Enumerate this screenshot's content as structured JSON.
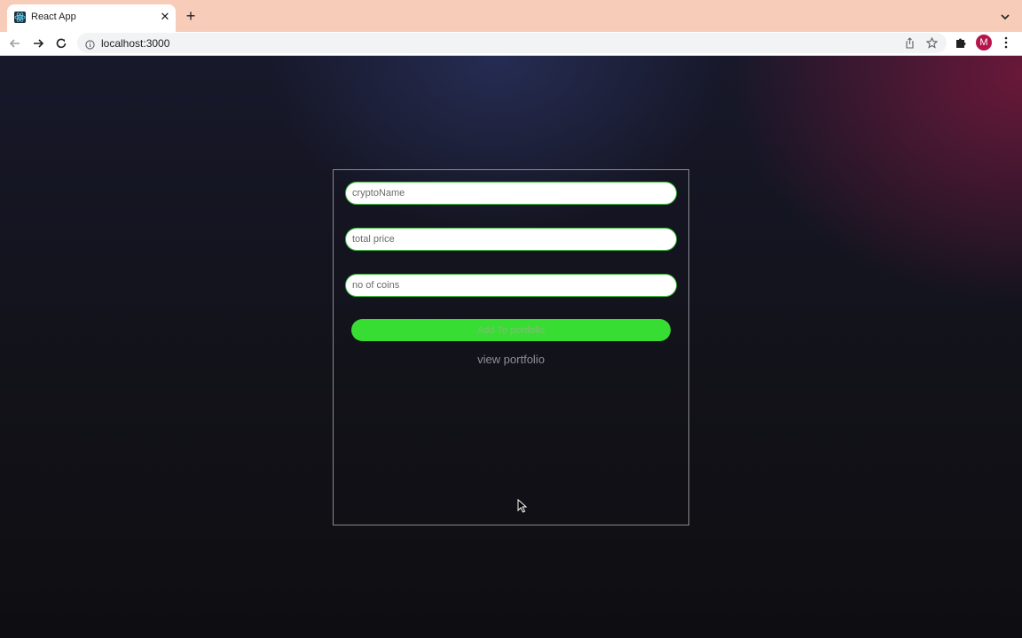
{
  "browser": {
    "tab_title": "React App",
    "tab_close": "✕",
    "new_tab": "+",
    "url": "localhost:3000",
    "avatar_letter": "M",
    "accent_tabstrip": "#f7cdb9",
    "avatar_color": "#b5154b"
  },
  "form": {
    "crypto_name_placeholder": "cryptoName",
    "total_price_placeholder": "total price",
    "coins_placeholder": "no of coins",
    "add_button_label": "Add To portfolio",
    "view_link_label": "view portfolio",
    "field_border_color": "#3dbf3d",
    "button_color": "#38dd34"
  },
  "icons": {
    "favicon": "react-logo-icon",
    "back": "arrow-left-icon",
    "forward": "arrow-right-icon",
    "reload": "reload-icon",
    "info": "info-icon",
    "share": "share-icon",
    "bookmark": "star-icon",
    "extensions": "puzzle-icon",
    "menu": "kebab-menu-icon"
  }
}
